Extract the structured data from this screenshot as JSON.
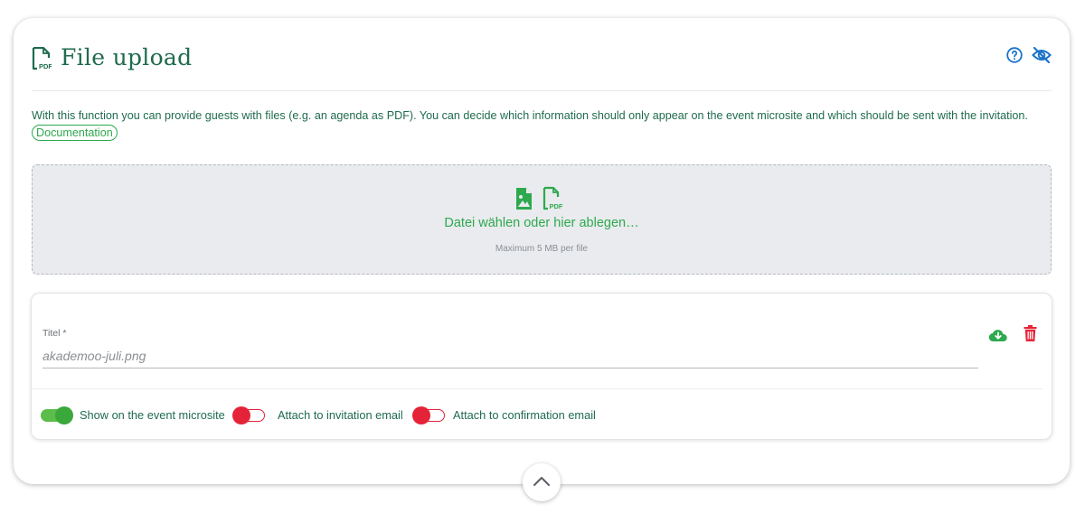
{
  "header": {
    "title": "File upload",
    "title_icon": "pdf-file-icon",
    "help_icon": "help-circle-icon",
    "visibility_icon": "eye-off-icon"
  },
  "description": {
    "text": "With this function you can provide guests with files (e.g. an agenda as PDF). You can decide which information should only appear on the event microsite and which should be sent with the invitation.",
    "link_label": "Documentation"
  },
  "dropzone": {
    "icons": [
      "image-file-icon",
      "pdf-file-icon"
    ],
    "label": "Datei wählen oder hier ablegen…",
    "hint": "Maximum 5 MB per file"
  },
  "file": {
    "title_label": "Titel *",
    "title_placeholder": "akademoo-juli.png",
    "actions": [
      "cloud-download-icon",
      "trash-icon"
    ],
    "toggles": [
      {
        "label": "Show on the event microsite",
        "checked": true
      },
      {
        "label": "Attach to invitation email",
        "checked": false
      },
      {
        "label": "Attach to confirmation email",
        "checked": false
      }
    ]
  },
  "colors": {
    "primary_text": "#1f6b4e",
    "accent_green": "#2ea94e",
    "toggle_on": "#3aa83a",
    "toggle_off": "#e52338",
    "delete_red": "#e52338"
  }
}
